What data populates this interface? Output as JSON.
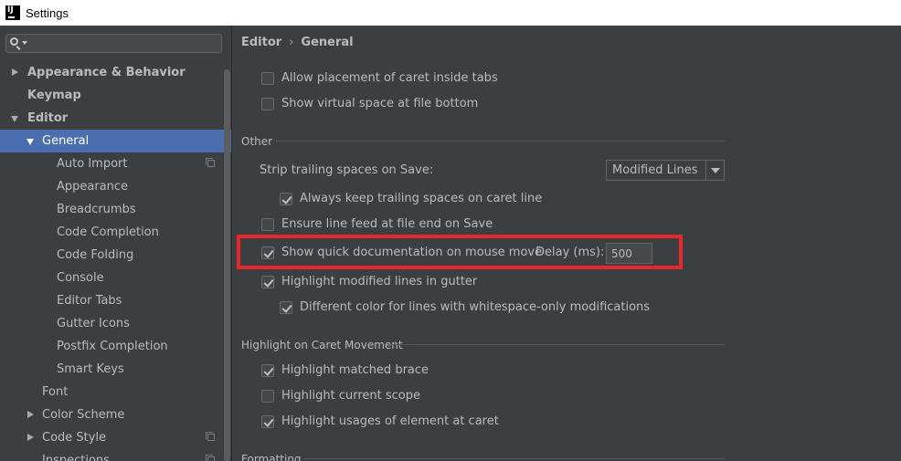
{
  "window": {
    "title": "Settings"
  },
  "search": {
    "placeholder": ""
  },
  "sidebar": {
    "items": [
      {
        "label": "Appearance & Behavior"
      },
      {
        "label": "Keymap"
      },
      {
        "label": "Editor"
      },
      {
        "label": "General"
      },
      {
        "label": "Auto Import"
      },
      {
        "label": "Appearance"
      },
      {
        "label": "Breadcrumbs"
      },
      {
        "label": "Code Completion"
      },
      {
        "label": "Code Folding"
      },
      {
        "label": "Console"
      },
      {
        "label": "Editor Tabs"
      },
      {
        "label": "Gutter Icons"
      },
      {
        "label": "Postfix Completion"
      },
      {
        "label": "Smart Keys"
      },
      {
        "label": "Font"
      },
      {
        "label": "Color Scheme"
      },
      {
        "label": "Code Style"
      },
      {
        "label": "Inspections"
      }
    ]
  },
  "breadcrumb": {
    "parent": "Editor",
    "separator": "›",
    "current": "General"
  },
  "top_options": {
    "allow_caret_tabs": {
      "label": "Allow placement of caret inside tabs",
      "checked": false
    },
    "virtual_space_bottom": {
      "label": "Show virtual space at file bottom",
      "checked": false
    }
  },
  "other": {
    "title": "Other",
    "strip_trailing": {
      "label": "Strip trailing spaces on Save:",
      "value": "Modified Lines"
    },
    "keep_trailing": {
      "label": "Always keep trailing spaces on caret line",
      "checked": true
    },
    "line_feed": {
      "label": "Ensure line feed at file end on Save",
      "checked": false
    },
    "quick_doc": {
      "label": "Show quick documentation on mouse move",
      "checked": true,
      "delay_label": "Delay (ms):",
      "delay_value": "500"
    },
    "highlight_modified": {
      "label": "Highlight modified lines in gutter",
      "checked": true
    },
    "whitespace_color": {
      "label": "Different color for lines with whitespace-only modifications",
      "checked": true
    }
  },
  "caret": {
    "title": "Highlight on Caret Movement",
    "matched_brace": {
      "label": "Highlight matched brace",
      "checked": true
    },
    "current_scope": {
      "label": "Highlight current scope",
      "checked": false
    },
    "usages": {
      "label": "Highlight usages of element at caret",
      "checked": true
    }
  },
  "formatting": {
    "title": "Formatting"
  },
  "colors": {
    "highlight_box": "#e8272a",
    "selection": "#4b6eaf"
  }
}
